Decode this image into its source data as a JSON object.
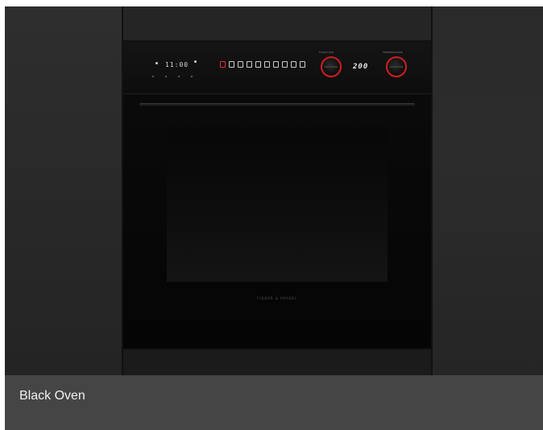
{
  "caption": "Black Oven",
  "oven": {
    "clock_display": "11:00",
    "temperature_display": "200",
    "brand_text": "FISHER & PAYKEL",
    "knob_left_label": "FUNCTION",
    "knob_right_label": "TEMPERATURE",
    "function_icon_count": 10,
    "accent_color": "#d21e1e"
  }
}
